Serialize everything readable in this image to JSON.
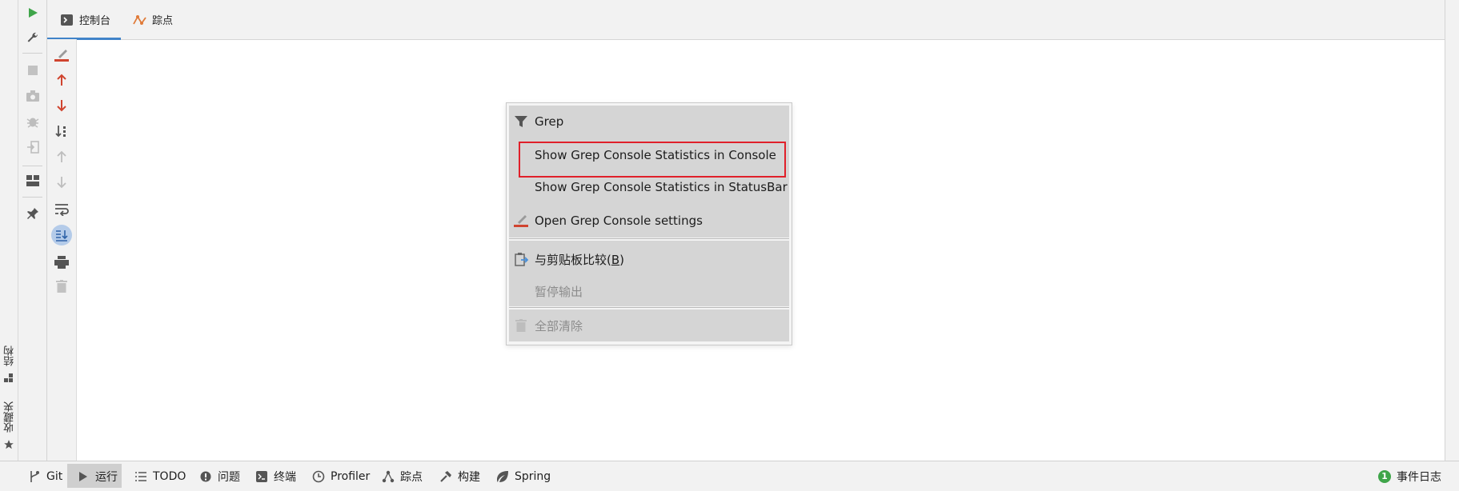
{
  "tabs": [
    {
      "label": "控制台",
      "icon": "console-icon",
      "active": true
    },
    {
      "label": "踪点",
      "icon": "trace-icon",
      "active": false
    }
  ],
  "side_panels": {
    "structure": "结构",
    "favorites": "收藏夹"
  },
  "context_menu": {
    "header": "Grep",
    "items": [
      {
        "label": "Show Grep Console Statistics in Console",
        "highlighted": true,
        "enabled": true
      },
      {
        "label": "Show Grep Console Statistics in StatusBar",
        "highlighted": false,
        "enabled": true
      },
      {
        "label": "Open Grep Console settings",
        "icon": "grep-settings-icon",
        "enabled": true
      }
    ],
    "compare_clipboard": "与剪贴板比较(",
    "compare_clipboard_mnemonic": "B",
    "compare_clipboard_close": ")",
    "pause_output": "暂停输出",
    "clear_all": "全部清除"
  },
  "status_bar": {
    "git": "Git",
    "run": "运行",
    "todo": "TODO",
    "problems": "问题",
    "terminal": "终端",
    "profiler": "Profiler",
    "trace": "踪点",
    "build": "构建",
    "spring": "Spring",
    "event_log": "事件日志",
    "event_log_count": "1"
  },
  "colors": {
    "accent": "#4083c9",
    "run_green": "#3fa54a",
    "arrow_red": "#d0442f",
    "highlight_border": "#e0202a",
    "event_badge": "#3fa54a"
  }
}
